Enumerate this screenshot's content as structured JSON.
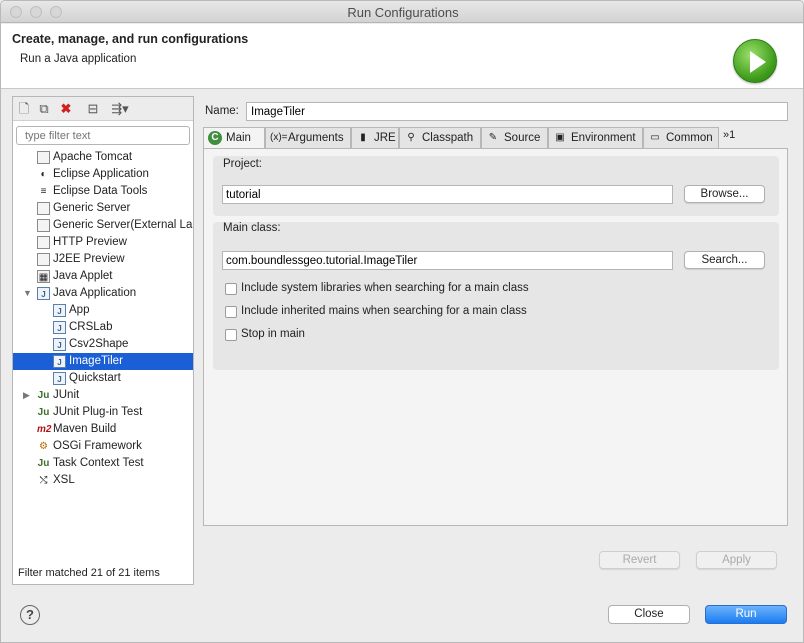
{
  "window": {
    "title": "Run Configurations"
  },
  "header": {
    "title": "Create, manage, and run configurations",
    "subtitle": "Run a Java application"
  },
  "left": {
    "filter_placeholder": "type filter text",
    "tree": [
      {
        "label": "Apache Tomcat",
        "icon": "doc",
        "level": 1
      },
      {
        "label": "Eclipse Application",
        "icon": "eclipse",
        "level": 1
      },
      {
        "label": "Eclipse Data Tools",
        "icon": "db",
        "level": 1
      },
      {
        "label": "Generic Server",
        "icon": "doc",
        "level": 1
      },
      {
        "label": "Generic Server(External La",
        "icon": "doc",
        "level": 1
      },
      {
        "label": "HTTP Preview",
        "icon": "doc",
        "level": 1
      },
      {
        "label": "J2EE Preview",
        "icon": "doc",
        "level": 1
      },
      {
        "label": "Java Applet",
        "icon": "applet",
        "level": 1
      },
      {
        "label": "Java Application",
        "icon": "j",
        "level": 1,
        "expanded": true
      },
      {
        "label": "App",
        "icon": "j",
        "level": 2
      },
      {
        "label": "CRSLab",
        "icon": "j",
        "level": 2
      },
      {
        "label": "Csv2Shape",
        "icon": "j",
        "level": 2
      },
      {
        "label": "ImageTiler",
        "icon": "j",
        "level": 2,
        "selected": true
      },
      {
        "label": "Quickstart",
        "icon": "j",
        "level": 2
      },
      {
        "label": "JUnit",
        "icon": "ju",
        "level": 1,
        "collapsed": true
      },
      {
        "label": "JUnit Plug-in Test",
        "icon": "ju",
        "level": 1
      },
      {
        "label": "Maven Build",
        "icon": "m2",
        "level": 1
      },
      {
        "label": "OSGi Framework",
        "icon": "osgi",
        "level": 1
      },
      {
        "label": "Task Context Test",
        "icon": "ju",
        "level": 1
      },
      {
        "label": "XSL",
        "icon": "xsl",
        "level": 1
      }
    ],
    "status": "Filter matched 21 of 21 items"
  },
  "right": {
    "name_label": "Name:",
    "name_value": "ImageTiler",
    "tabs": [
      {
        "label": "Main",
        "icon": "C"
      },
      {
        "label": "Arguments",
        "icon": "(x)="
      },
      {
        "label": "JRE",
        "icon": "▮"
      },
      {
        "label": "Classpath",
        "icon": "⚲"
      },
      {
        "label": "Source",
        "icon": "✎"
      },
      {
        "label": "Environment",
        "icon": "▣"
      },
      {
        "label": "Common",
        "icon": "▭"
      }
    ],
    "overflow": "»1",
    "project_label": "Project:",
    "project_value": "tutorial",
    "browse": "Browse...",
    "mainclass_label": "Main class:",
    "mainclass_value": "com.boundlessgeo.tutorial.ImageTiler",
    "search": "Search...",
    "checks": [
      "Include system libraries when searching for a main class",
      "Include inherited mains when searching for a main class",
      "Stop in main"
    ],
    "revert": "Revert",
    "apply": "Apply"
  },
  "footer": {
    "help": "?",
    "close": "Close",
    "run": "Run"
  }
}
